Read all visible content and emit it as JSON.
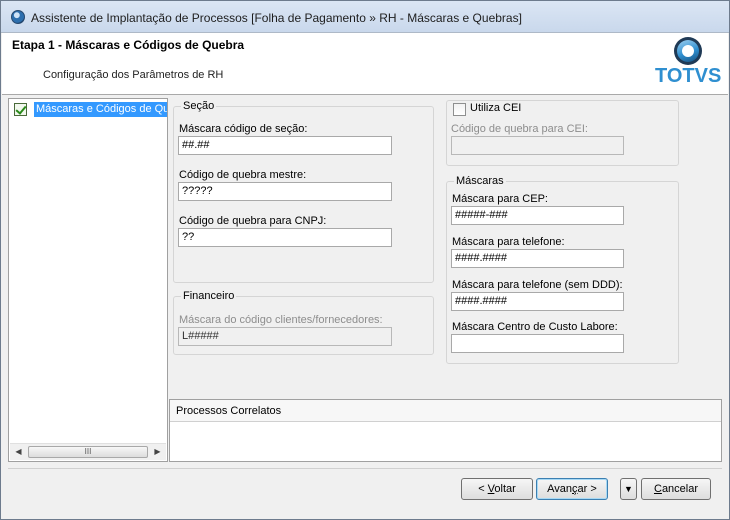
{
  "window": {
    "title": "Assistente de Implantação de Processos [Folha de Pagamento » RH - Máscaras e Quebras]"
  },
  "header": {
    "step_title": "Etapa 1 - Máscaras e Códigos de Quebra",
    "subtitle": "Configuração dos Parâmetros de RH",
    "logo_text": "TOTVS"
  },
  "tree": {
    "items": [
      {
        "label": "Máscaras e Códigos de Quebra",
        "selected": true
      }
    ],
    "scroll_thumb": "III"
  },
  "secao": {
    "legend": "Seção",
    "mask_label": "Máscara código de seção:",
    "mask_value": "##.##",
    "master_label": "Código de quebra mestre:",
    "master_value": "?????",
    "cnpj_label": "Código de quebra para CNPJ:",
    "cnpj_value": "??"
  },
  "financeiro": {
    "legend": "Financeiro",
    "mask_label": "Máscara do código clientes/fornecedores:",
    "mask_value": "L#####"
  },
  "cei": {
    "checkbox_label": "Utiliza CEI",
    "checked": false,
    "code_label": "Código de quebra para CEI:",
    "code_value": ""
  },
  "mascaras": {
    "legend": "Máscaras",
    "cep_label": "Máscara para CEP:",
    "cep_value": "#####-###",
    "phone_label": "Máscara para telefone:",
    "phone_value": "####.####",
    "phone_noddd_label": "Máscara para telefone (sem DDD):",
    "phone_noddd_value": "####.####",
    "cc_label": "Máscara Centro de Custo Labore:",
    "cc_value": ""
  },
  "correlatos": {
    "header": "Processos Correlatos"
  },
  "buttons": {
    "back_prefix": "< ",
    "back_key": "V",
    "back_rest": "oltar",
    "next_prefix": "Avan",
    "next_key": "ç",
    "next_rest": "ar >",
    "dropdown": "▼",
    "cancel_key": "C",
    "cancel_rest": "ancelar"
  }
}
